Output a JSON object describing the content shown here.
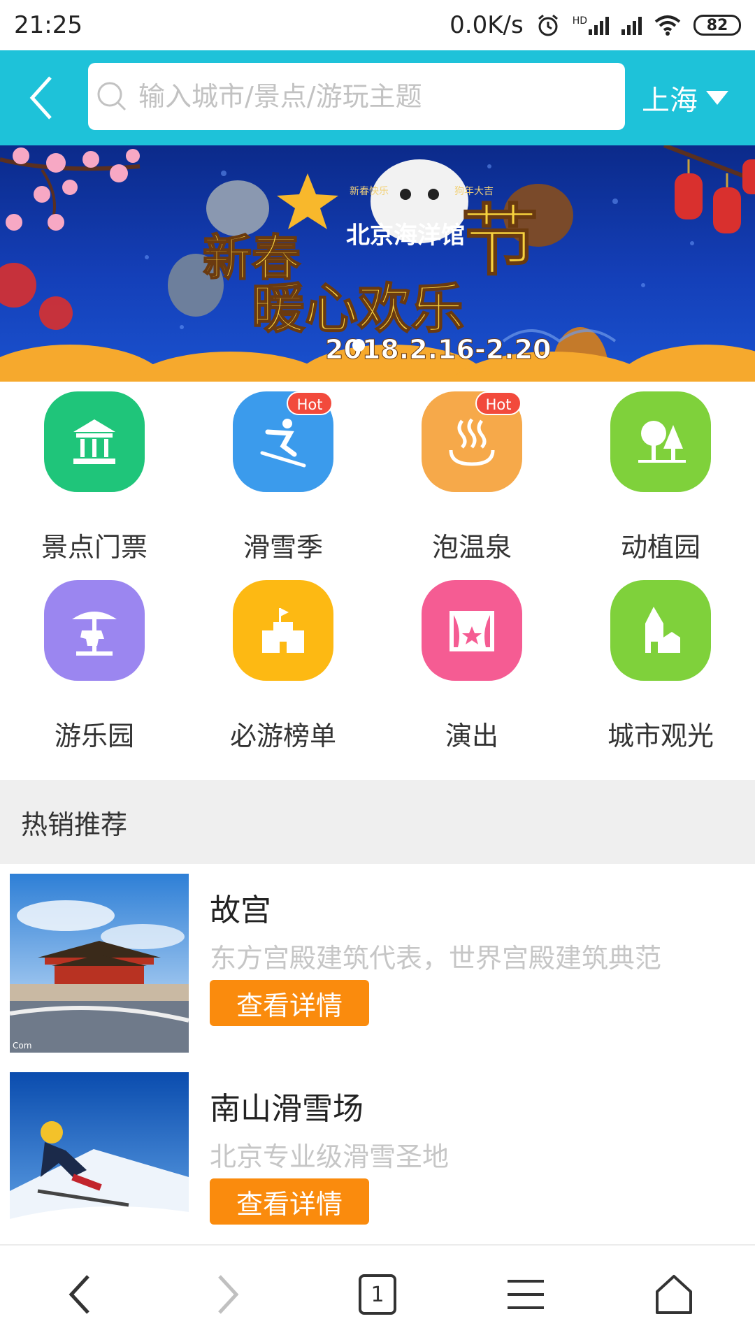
{
  "status_bar": {
    "time": "21:25",
    "net_speed": "0.0K/s",
    "hd_label": "HD",
    "battery": "82"
  },
  "header": {
    "search_placeholder": "输入城市/景点/游玩主题",
    "city": "上海",
    "accent_color": "#1ec2d9"
  },
  "banner": {
    "line1": "新春",
    "line1b": "节",
    "line2": "暖心欢乐",
    "venue": "北京海洋馆",
    "dates": "2018.2.16-2.20",
    "tag_left": "新春快乐",
    "tag_right": "狗年大吉"
  },
  "categories": [
    {
      "label": "景点门票",
      "icon": "pavilion-icon",
      "color": "#1fc57a",
      "hot": ""
    },
    {
      "label": "滑雪季",
      "icon": "skier-icon",
      "color": "#3b9bec",
      "hot": "Hot"
    },
    {
      "label": "泡温泉",
      "icon": "hot-spring-icon",
      "color": "#f6a94a",
      "hot": "Hot"
    },
    {
      "label": "动植园",
      "icon": "trees-icon",
      "color": "#7fd13b",
      "hot": ""
    },
    {
      "label": "游乐园",
      "icon": "carousel-icon",
      "color": "#9b86f0",
      "hot": ""
    },
    {
      "label": "必游榜单",
      "icon": "castle-icon",
      "color": "#fdb913",
      "hot": ""
    },
    {
      "label": "演出",
      "icon": "stage-icon",
      "color": "#f55c93",
      "hot": ""
    },
    {
      "label": "城市观光",
      "icon": "tower-icon",
      "color": "#7fd13b",
      "hot": ""
    }
  ],
  "section": {
    "title": "热销推荐"
  },
  "products": [
    {
      "title": "故宫",
      "desc": "东方宫殿建筑代表，世界宫殿建筑典范",
      "button": "查看详情",
      "watermark": "Com"
    },
    {
      "title": "南山滑雪场",
      "desc": "北京专业级滑雪圣地",
      "button": "查看详情"
    }
  ],
  "bottom_nav": {
    "tab_count": "1"
  }
}
